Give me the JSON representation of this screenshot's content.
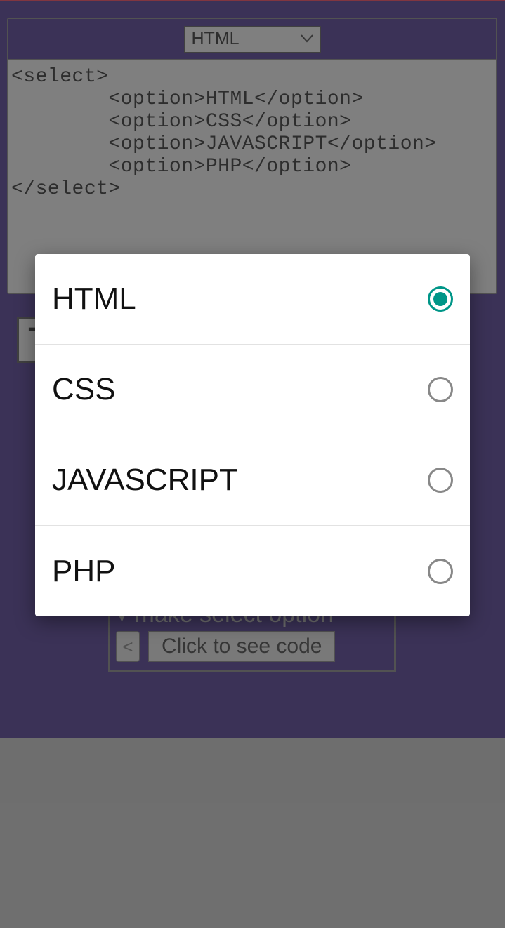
{
  "header": {
    "selected_value": "HTML"
  },
  "code": {
    "text": "<select>\n        <option>HTML</option>\n        <option>CSS</option>\n        <option>JAVASCRIPT</option>\n        <option>PHP</option>\n</select>"
  },
  "badge": {
    "letter": "T"
  },
  "bottom_widget": {
    "title": "▾ make select option",
    "lt": "<",
    "button_label": "Click to see code"
  },
  "dropdown": {
    "options": [
      {
        "label": "HTML",
        "selected": true
      },
      {
        "label": "CSS",
        "selected": false
      },
      {
        "label": "JAVASCRIPT",
        "selected": false
      },
      {
        "label": "PHP",
        "selected": false
      }
    ]
  },
  "colors": {
    "app_bg": "#2a1a5e",
    "panel_bg": "#a6a6a6",
    "accent": "#009688"
  }
}
